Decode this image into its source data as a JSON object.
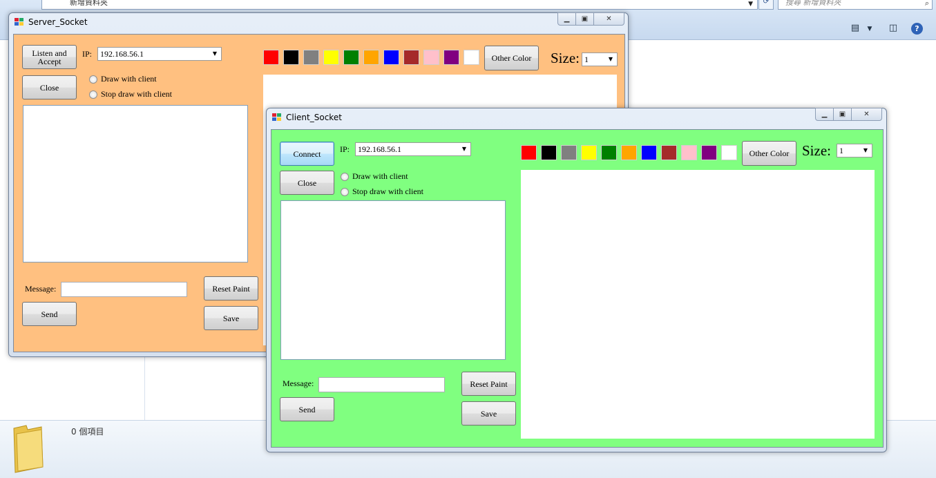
{
  "explorer": {
    "address": "新增資料夾",
    "search_placeholder": "搜尋 新增資料夾",
    "item_count": "0 個項目"
  },
  "server": {
    "title": "Server_Socket",
    "listen_label": "Listen and Accept",
    "close_label": "Close",
    "ip_label": "IP:",
    "ip_value": "192.168.56.1",
    "draw_label": "Draw with client",
    "stop_label": "Stop draw with client",
    "message_label": "Message:",
    "send_label": "Send",
    "reset_label": "Reset Paint",
    "save_label": "Save",
    "other_color_label": "Other Color",
    "size_label": "Size:",
    "size_value": "1",
    "bg": "#ffc080"
  },
  "client": {
    "title": "Client_Socket",
    "connect_label": "Connect",
    "close_label": "Close",
    "ip_label": "IP:",
    "ip_value": "192.168.56.1",
    "draw_label": "Draw with client",
    "stop_label": "Stop draw with client",
    "message_label": "Message:",
    "send_label": "Send",
    "reset_label": "Reset Paint",
    "save_label": "Save",
    "other_color_label": "Other Color",
    "size_label": "Size:",
    "size_value": "1",
    "bg": "#80ff80"
  },
  "palette": [
    {
      "name": "red",
      "hex": "#ff0000"
    },
    {
      "name": "black",
      "hex": "#000000"
    },
    {
      "name": "gray",
      "hex": "#808080"
    },
    {
      "name": "yellow",
      "hex": "#ffff00"
    },
    {
      "name": "green",
      "hex": "#008000"
    },
    {
      "name": "orange",
      "hex": "#ffa500"
    },
    {
      "name": "blue",
      "hex": "#0000ff"
    },
    {
      "name": "brown",
      "hex": "#a52a2a"
    },
    {
      "name": "pink",
      "hex": "#ffc0cb"
    },
    {
      "name": "purple",
      "hex": "#800080"
    },
    {
      "name": "white",
      "hex": "#ffffff"
    }
  ],
  "icons": {
    "minimize": "minimize-icon",
    "maximize": "maximize-icon",
    "close": "close-icon",
    "dropdown": "chevron-down-icon",
    "folder": "folder-icon",
    "search": "search-icon",
    "help": "help-icon"
  }
}
